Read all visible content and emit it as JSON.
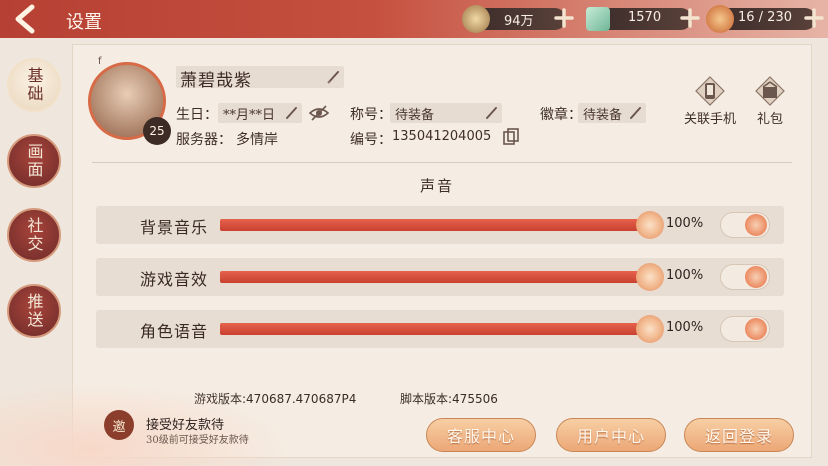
{
  "header": {
    "title": "设置",
    "resources": [
      {
        "name": "coin",
        "value": "94万"
      },
      {
        "name": "jade",
        "value": "1570"
      },
      {
        "name": "stamina",
        "value": "16 / 230"
      }
    ]
  },
  "sidebar": {
    "tabs": [
      {
        "label": "基础",
        "active": true
      },
      {
        "label": "画面",
        "active": false
      },
      {
        "label": "社交",
        "active": false
      },
      {
        "label": "推送",
        "active": false
      }
    ]
  },
  "profile": {
    "avatar_mark": "f",
    "level": "25",
    "name": "萧碧哉紫",
    "birthday_label": "生日：",
    "birthday_value": "**月**日",
    "server_label": "服务器：",
    "server_value": "多情岸",
    "title_label": "称号：",
    "title_value": "待装备",
    "badge_label": "徽章：",
    "badge_value": "待装备",
    "id_label": "编号：",
    "id_value": "135041204005"
  },
  "tools": {
    "phone_label": "关联手机",
    "gift_label": "礼包"
  },
  "sound": {
    "section_title": "声音",
    "rows": [
      {
        "label": "背景音乐",
        "percent_text": "100%",
        "level": 1.0,
        "enabled": true
      },
      {
        "label": "游戏音效",
        "percent_text": "100%",
        "level": 1.0,
        "enabled": true
      },
      {
        "label": "角色语音",
        "percent_text": "100%",
        "level": 1.0,
        "enabled": true
      }
    ]
  },
  "footer": {
    "game_version": "游戏版本:470687.470687P4",
    "script_version": "脚本版本:475506",
    "invite_seal": "邀",
    "invite_title": "接受好友款待",
    "invite_sub": "30级前可接受好友款待",
    "buttons": {
      "service": "客服中心",
      "user_center": "用户中心",
      "back_login": "返回登录"
    }
  },
  "colors": {
    "accent": "#c6503f",
    "slider_fill": "#d9503b",
    "button": "#eca776"
  }
}
